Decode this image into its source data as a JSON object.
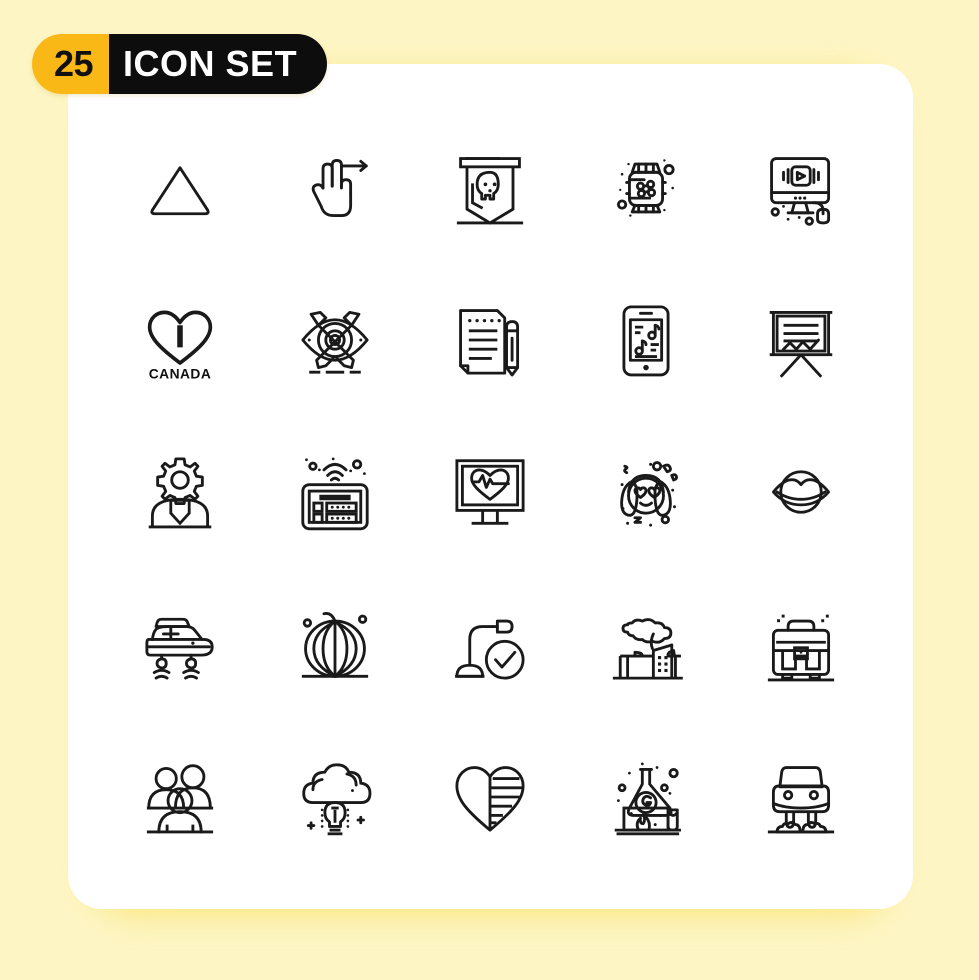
{
  "meta": {
    "background_color": "#fdf5c4",
    "card_color": "#ffffff",
    "shadow_color": "#f7d21a",
    "stroke_color": "#1a1a1a",
    "accent_yellow": "#f9b816",
    "accent_black": "#0d0d0d"
  },
  "badge": {
    "count": "25",
    "title": "ICON SET"
  },
  "grid": {
    "columns": 5,
    "rows": 5,
    "total_icons": 25
  },
  "icons": [
    {
      "index": 1,
      "row": 1,
      "col": 1,
      "name": "triangle-up-icon",
      "label": "Triangle"
    },
    {
      "index": 2,
      "row": 1,
      "col": 2,
      "name": "swipe-right-gesture-icon",
      "label": "Swipe Right Gesture"
    },
    {
      "index": 3,
      "row": 1,
      "col": 3,
      "name": "pirate-skull-banner-icon",
      "label": "Pirate Flag"
    },
    {
      "index": 4,
      "row": 1,
      "col": 4,
      "name": "smartwatch-apps-icon",
      "label": "Smart Watch"
    },
    {
      "index": 5,
      "row": 1,
      "col": 5,
      "name": "desktop-video-player-icon",
      "label": "Video Monitor"
    },
    {
      "index": 6,
      "row": 2,
      "col": 1,
      "name": "i-love-canada-heart-icon",
      "label": "I Love Canada",
      "text_top": "I",
      "text_bottom": "CANADA"
    },
    {
      "index": 7,
      "row": 2,
      "col": 2,
      "name": "graphic-design-tools-icon",
      "label": "Graphic Design"
    },
    {
      "index": 8,
      "row": 2,
      "col": 3,
      "name": "document-pencil-icon",
      "label": "Document Edit"
    },
    {
      "index": 9,
      "row": 2,
      "col": 4,
      "name": "smartphone-music-icon",
      "label": "Mobile Music"
    },
    {
      "index": 10,
      "row": 2,
      "col": 5,
      "name": "presentation-chart-icon",
      "label": "Presentation Board"
    },
    {
      "index": 11,
      "row": 3,
      "col": 1,
      "name": "user-settings-gear-icon",
      "label": "User Settings"
    },
    {
      "index": 12,
      "row": 3,
      "col": 2,
      "name": "tablet-wifi-icon",
      "label": "Wireless Tablet"
    },
    {
      "index": 13,
      "row": 3,
      "col": 3,
      "name": "heart-rate-monitor-icon",
      "label": "Heart Monitor"
    },
    {
      "index": 14,
      "row": 3,
      "col": 4,
      "name": "girl-heart-eyes-emoji-icon",
      "label": "Love Emoji"
    },
    {
      "index": 15,
      "row": 3,
      "col": 5,
      "name": "lips-mouth-icon",
      "label": "Lips"
    },
    {
      "index": 16,
      "row": 4,
      "col": 1,
      "name": "hover-car-side-icon",
      "label": "Hover Car"
    },
    {
      "index": 17,
      "row": 4,
      "col": 2,
      "name": "pumpkin-icon",
      "label": "Pumpkin"
    },
    {
      "index": 18,
      "row": 4,
      "col": 3,
      "name": "microphone-check-icon",
      "label": "Microphone Approved"
    },
    {
      "index": 19,
      "row": 4,
      "col": 4,
      "name": "factory-smoke-icon",
      "label": "Factory"
    },
    {
      "index": 20,
      "row": 4,
      "col": 5,
      "name": "briefcase-icon",
      "label": "Briefcase"
    },
    {
      "index": 21,
      "row": 5,
      "col": 1,
      "name": "people-group-icon",
      "label": "Team"
    },
    {
      "index": 22,
      "row": 5,
      "col": 2,
      "name": "cloud-idea-bulb-icon",
      "label": "Cloud Idea"
    },
    {
      "index": 23,
      "row": 5,
      "col": 3,
      "name": "striped-heart-icon",
      "label": "Striped Heart"
    },
    {
      "index": 24,
      "row": 5,
      "col": 4,
      "name": "chemistry-lab-flask-icon",
      "label": "Chemistry Lab",
      "text_glyph": "G"
    },
    {
      "index": 25,
      "row": 5,
      "col": 5,
      "name": "hover-car-front-icon",
      "label": "Hover Car Front"
    }
  ]
}
